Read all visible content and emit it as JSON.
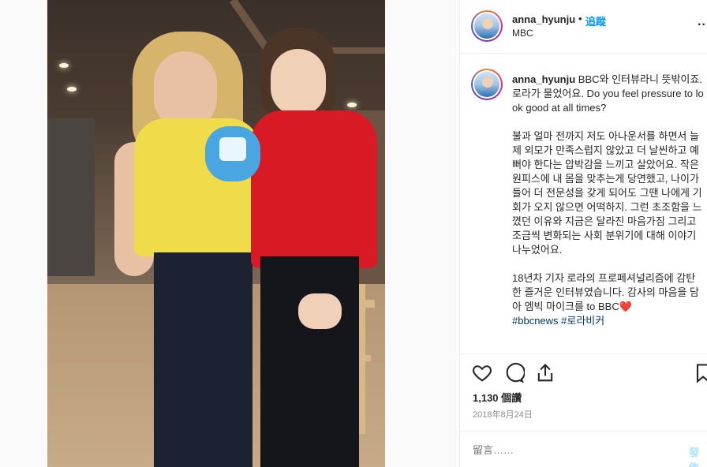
{
  "post": {
    "username": "anna_hyunju",
    "separator": "•",
    "follow_label": "追蹤",
    "location": "MBC",
    "more_label": "..."
  },
  "caption": {
    "username": "anna_hyunju",
    "text": " BBC와 인터뷰라니 뜻밖이죠. 로라가 물었어요. Do you feel pressure to look good at all times?\n\n불과 얼마 전까지 저도 아나운서를 하면서 늘 제 외모가 만족스럽지 않았고 더 날씬하고 예뻐야 한다는 압박감을 느끼고 살았어요. 작은 원피스에 내 몸을 맞추는게 당연했고, 나이가 들어 더 전문성을 갖게 되어도 그땐 나에게 기회가 오지 않으면 어떡하지. 그런 초조함을 느꼈던 이유와 지금은 달라진 마음가짐 그리고 조금씩 변화되는 사회 분위기에 대해 이야기 나누었어요.\n\n18년차 기자 로라의 프로페셔널리즘에 감탄한 즐거운 인터뷰였습니다. 감사의 마음을 담아 엠빅 마이크를 to BBC❤️\n",
    "hashtags": "#bbcnews #로라비커"
  },
  "actions": {
    "like_icon": "heart-outline-icon",
    "comment_icon": "comment-bubble-icon",
    "share_icon": "share-upload-icon",
    "save_icon": "bookmark-icon"
  },
  "stats": {
    "views": "1,130 個讚",
    "date": "2018年8月24日"
  },
  "comment": {
    "placeholder": "留言……",
    "post_label": "發佈"
  },
  "colors": {
    "accent": "#0095f6",
    "post_disabled": "#b2dffc",
    "hashtag": "#00376b"
  }
}
